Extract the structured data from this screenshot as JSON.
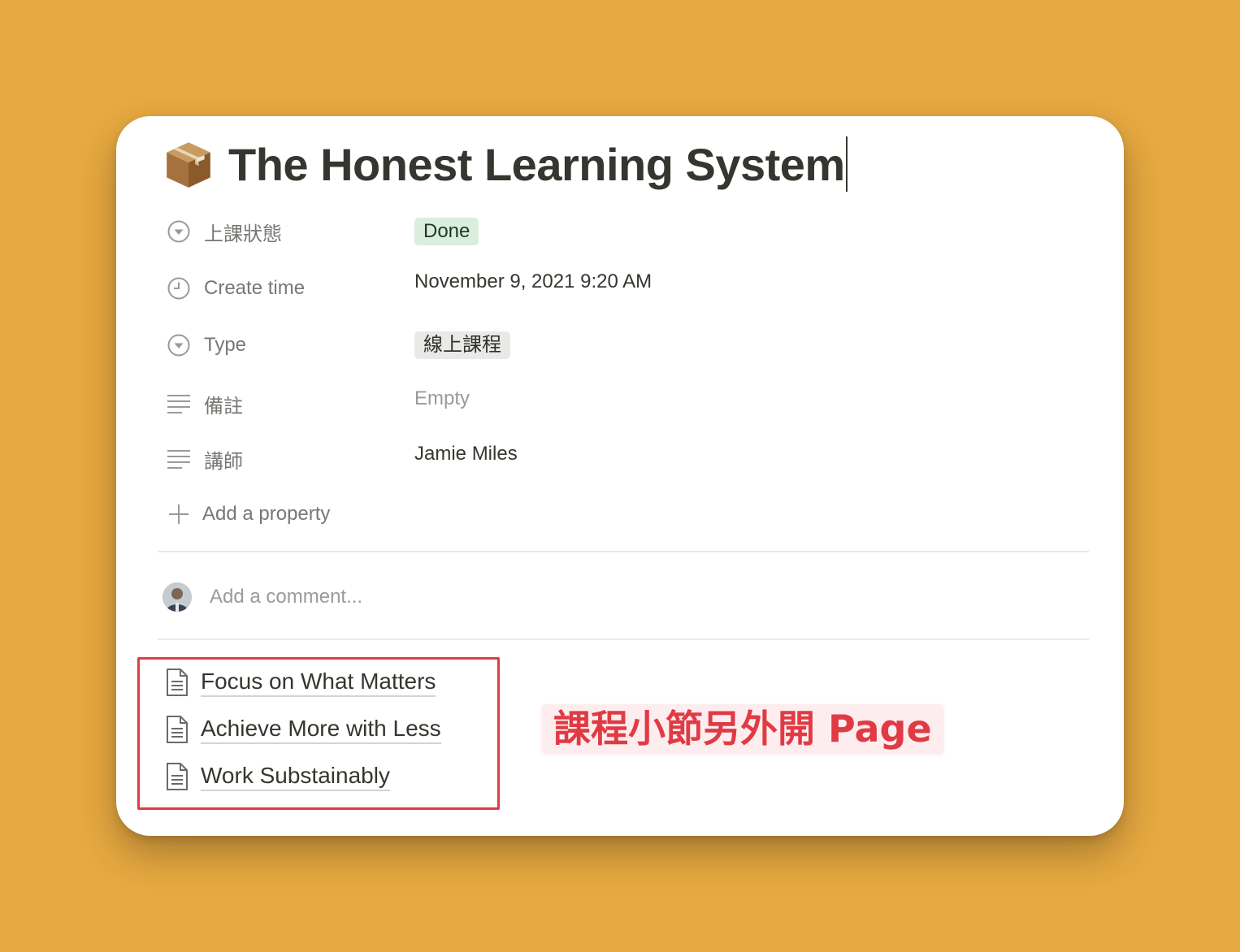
{
  "page": {
    "icon": "package-emoji-icon",
    "title": "The Honest Learning System"
  },
  "properties": [
    {
      "icon": "select-icon",
      "label": "上課狀態",
      "value": "Done",
      "kind": "tag",
      "tag_color": "#DBEDDB"
    },
    {
      "icon": "clock-icon",
      "label": "Create time",
      "value": "November 9, 2021 9:20 AM",
      "kind": "text"
    },
    {
      "icon": "select-icon",
      "label": "Type",
      "value": "線上課程",
      "kind": "tag",
      "tag_color": "#E9E9E7"
    },
    {
      "icon": "text-lines-icon",
      "label": "備註",
      "value": "Empty",
      "kind": "empty"
    },
    {
      "icon": "text-lines-icon",
      "label": "講師",
      "value": "Jamie Miles",
      "kind": "text"
    }
  ],
  "add_property": {
    "icon": "plus-icon",
    "label": "Add a property"
  },
  "comment": {
    "placeholder": "Add a comment..."
  },
  "subpages": [
    {
      "icon": "page-icon",
      "title": "Focus on What Matters"
    },
    {
      "icon": "page-icon",
      "title": "Achieve More with Less"
    },
    {
      "icon": "page-icon",
      "title": "Work Substainably"
    }
  ],
  "annotation": {
    "text": "課程小節另外開 Page",
    "color": "#E03B45"
  },
  "colors": {
    "background": "#E7A941",
    "card": "#FFFFFF",
    "highlight": "#E03B45"
  }
}
